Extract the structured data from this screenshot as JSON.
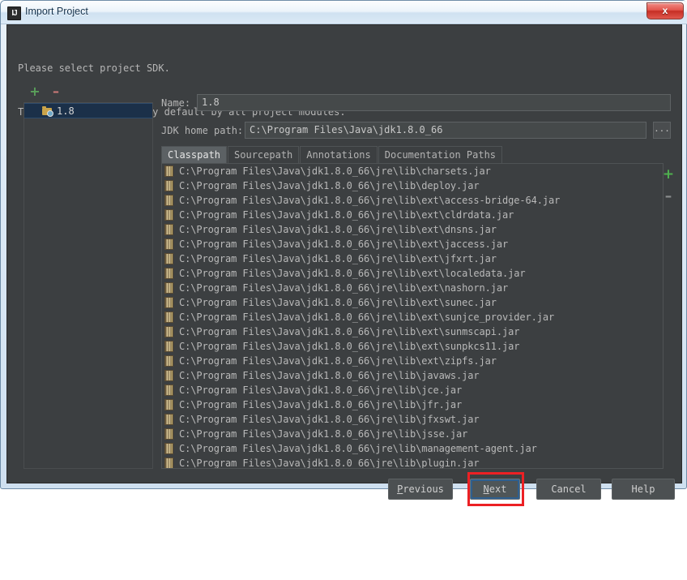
{
  "window": {
    "title": "Import Project",
    "icon": "intellij-idea-icon",
    "icon_text": "IJ",
    "close_label": "x"
  },
  "dialog": {
    "prompt_line1": "Please select project SDK.",
    "prompt_line2": "This SDK will be used by default by all project modules."
  },
  "sdk_panel": {
    "add_label": "+",
    "remove_label": "–",
    "items": [
      {
        "label": "1.8",
        "selected": true,
        "icon": "jdk-folder-icon"
      }
    ]
  },
  "fields": {
    "name_label": "Name:",
    "name_value": "1.8",
    "jdk_home_label": "JDK home path:",
    "jdk_home_value": "C:\\Program Files\\Java\\jdk1.8.0_66",
    "browse_label": "..."
  },
  "tabs": [
    {
      "label": "Classpath",
      "active": true
    },
    {
      "label": "Sourcepath",
      "active": false
    },
    {
      "label": "Annotations",
      "active": false
    },
    {
      "label": "Documentation Paths",
      "active": false
    }
  ],
  "classpath": {
    "add_label": "+",
    "remove_label": "–",
    "entries": [
      "C:\\Program Files\\Java\\jdk1.8.0_66\\jre\\lib\\charsets.jar",
      "C:\\Program Files\\Java\\jdk1.8.0_66\\jre\\lib\\deploy.jar",
      "C:\\Program Files\\Java\\jdk1.8.0_66\\jre\\lib\\ext\\access-bridge-64.jar",
      "C:\\Program Files\\Java\\jdk1.8.0_66\\jre\\lib\\ext\\cldrdata.jar",
      "C:\\Program Files\\Java\\jdk1.8.0_66\\jre\\lib\\ext\\dnsns.jar",
      "C:\\Program Files\\Java\\jdk1.8.0_66\\jre\\lib\\ext\\jaccess.jar",
      "C:\\Program Files\\Java\\jdk1.8.0_66\\jre\\lib\\ext\\jfxrt.jar",
      "C:\\Program Files\\Java\\jdk1.8.0_66\\jre\\lib\\ext\\localedata.jar",
      "C:\\Program Files\\Java\\jdk1.8.0_66\\jre\\lib\\ext\\nashorn.jar",
      "C:\\Program Files\\Java\\jdk1.8.0_66\\jre\\lib\\ext\\sunec.jar",
      "C:\\Program Files\\Java\\jdk1.8.0_66\\jre\\lib\\ext\\sunjce_provider.jar",
      "C:\\Program Files\\Java\\jdk1.8.0_66\\jre\\lib\\ext\\sunmscapi.jar",
      "C:\\Program Files\\Java\\jdk1.8.0_66\\jre\\lib\\ext\\sunpkcs11.jar",
      "C:\\Program Files\\Java\\jdk1.8.0_66\\jre\\lib\\ext\\zipfs.jar",
      "C:\\Program Files\\Java\\jdk1.8.0_66\\jre\\lib\\javaws.jar",
      "C:\\Program Files\\Java\\jdk1.8.0_66\\jre\\lib\\jce.jar",
      "C:\\Program Files\\Java\\jdk1.8.0_66\\jre\\lib\\jfr.jar",
      "C:\\Program Files\\Java\\jdk1.8.0_66\\jre\\lib\\jfxswt.jar",
      "C:\\Program Files\\Java\\jdk1.8.0_66\\jre\\lib\\jsse.jar",
      "C:\\Program Files\\Java\\jdk1.8.0_66\\jre\\lib\\management-agent.jar",
      "C:\\Program Files\\Java\\jdk1.8.0_66\\jre\\lib\\plugin.jar"
    ]
  },
  "buttons": {
    "previous": {
      "prefix": "",
      "mnemonic": "P",
      "suffix": "revious"
    },
    "next": {
      "prefix": "",
      "mnemonic": "N",
      "suffix": "ext"
    },
    "cancel": {
      "label": "Cancel"
    },
    "help": {
      "label": "Help"
    }
  },
  "colors": {
    "dialog_bg": "#3c3f41",
    "selection_bg": "#1b3049",
    "accent_green": "#4fb14f",
    "accent_red": "#cc7a77",
    "highlight_red": "#ec2024",
    "focus_blue": "#2e5f8f"
  }
}
